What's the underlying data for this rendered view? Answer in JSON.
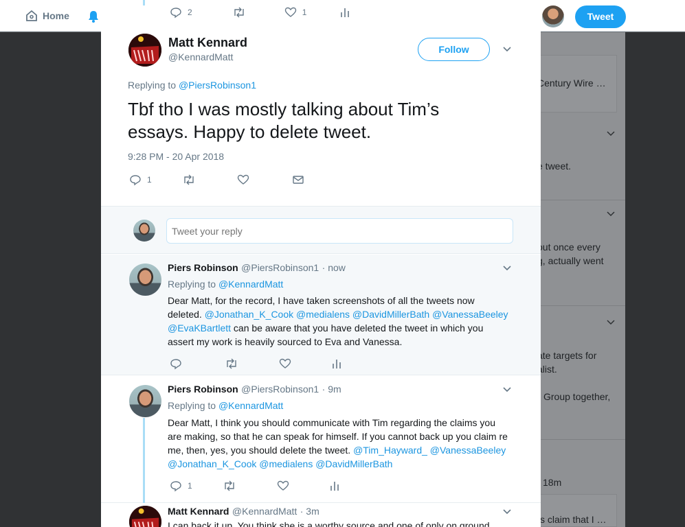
{
  "topbar": {
    "home_label": "Home",
    "tweet_label": "Tweet"
  },
  "background": {
    "cards": [
      {
        "text1": "Century Wire …",
        "text2": ""
      },
      {
        "text1": "e tweet.",
        "text2": ""
      },
      {
        "text1": "out once every",
        "text2": "g, actually went"
      },
      {
        "text1": "ate targets for",
        "text2": "alist.",
        "text3": "Group together,"
      },
      {
        "text1": "18m",
        "text2": "s claim that I …"
      }
    ]
  },
  "prev_actions": {
    "reply_count": "2",
    "like_count": "1"
  },
  "main": {
    "name": "Matt Kennard",
    "handle": "@KennardMatt",
    "follow_label": "Follow",
    "replying_prefix": "Replying to",
    "replying_handle": "@PiersRobinson1",
    "text_line1": "Tbf tho I was mostly talking about Tim’s",
    "text_line2": "essays. Happy to delete tweet.",
    "timestamp": "9:28 PM - 20 Apr 2018",
    "reply_count": "1"
  },
  "reply_box": {
    "placeholder": "Tweet your reply"
  },
  "replies": [
    {
      "name": "Piers Robinson",
      "handle": "@PiersRobinson1",
      "time": "· now",
      "replying_prefix": "Replying to",
      "replying_handle": "@KennardMatt",
      "l1": "Dear Matt, for the record, I have taken screenshots of all the tweets now",
      "l2a": "deleted. ",
      "l2b": "@Jonathan_K_Cook @medialens @DavidMillerBath @VanessaBeeley",
      "l3a": "@EvaKBartlett",
      "l3b": " can be aware that you have deleted the tweet in which you",
      "l4": "assert my work is heavily sourced to Eva and Vanessa."
    },
    {
      "name": "Piers Robinson",
      "handle": "@PiersRobinson1",
      "time": "· 9m",
      "replying_prefix": "Replying to",
      "replying_handle": "@KennardMatt",
      "l1": "Dear Matt, I think you should communicate with Tim regarding the claims you",
      "l2": "are making, so that he can speak for himself. If you cannot back up you claim re",
      "l3a": "me, then, yes, you should delete the tweet. ",
      "l3b": "@Tim_Hayward_ @VanessaBeeley",
      "l4": "@Jonathan_K_Cook @medialens @DavidMillerBath",
      "reply_count": "1"
    },
    {
      "name": "Matt Kennard",
      "handle": "@KennardMatt",
      "time": "· 3m",
      "l1": "I can back it up. You think she is a worthy source and one of only on ground"
    }
  ],
  "colors": {
    "accent": "#1da1f2",
    "link": "#1b95e0",
    "thread": "#a9ddf6"
  }
}
